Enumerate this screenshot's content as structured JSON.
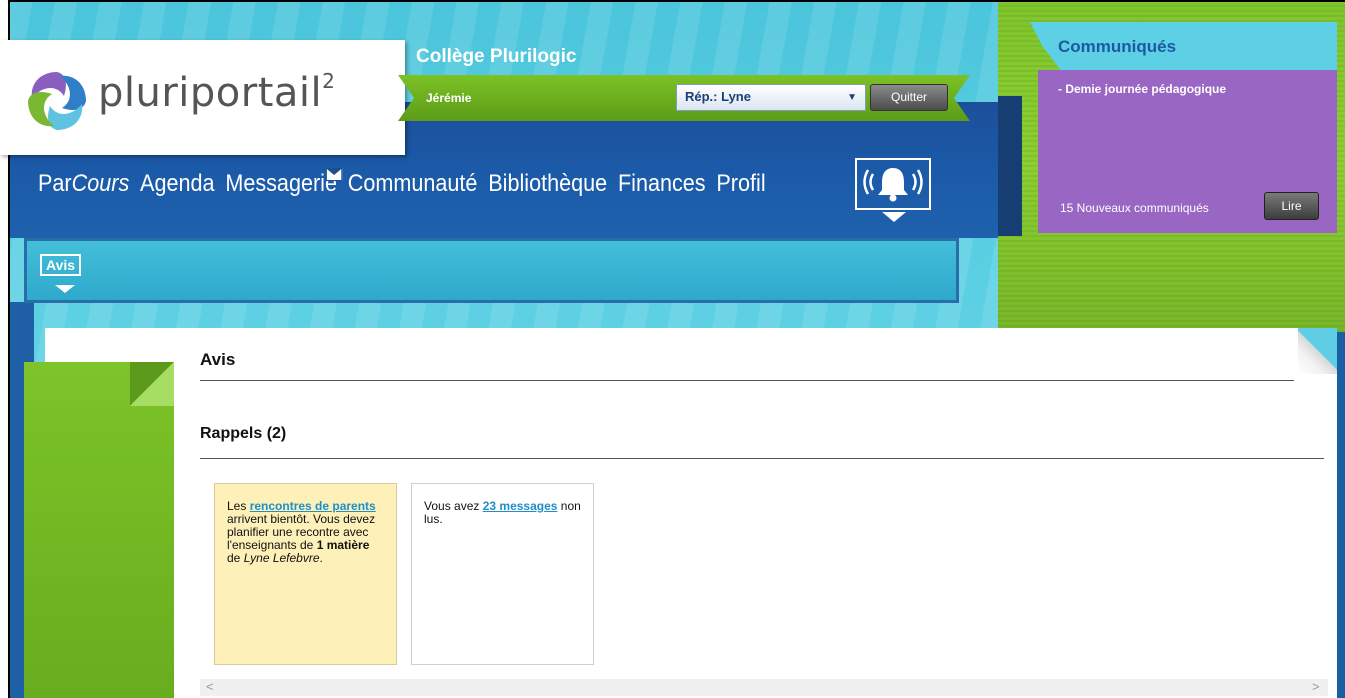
{
  "header": {
    "logo_text": "pluriportail",
    "logo_sup": "2",
    "school": "Collège Plurilogic",
    "user": "Jérémie",
    "rep_select": "Rép.: Lyne",
    "quit_label": "Quitter"
  },
  "nav": {
    "items": [
      {
        "prefix": "Par",
        "italic": "Cours"
      },
      {
        "label": "Agenda"
      },
      {
        "label": "Messagerie"
      },
      {
        "label": "Communauté"
      },
      {
        "label": "Bibliothèque"
      },
      {
        "label": "Finances"
      },
      {
        "label": "Profil"
      }
    ]
  },
  "subheader": {
    "tag": "Avis"
  },
  "communiques": {
    "title": "Communiqués",
    "item": "- Demie journée pédagogique",
    "count_text": "15 Nouveaux communiqués",
    "read_label": "Lire"
  },
  "main": {
    "title": "Avis",
    "section_title": "Rappels (2)",
    "cards": [
      {
        "pre": "Les ",
        "link": "rencontres de parents",
        "mid": " arrivent bientôt. Vous devez planifier une recontre avec l'enseignants de ",
        "bold": "1 matière",
        "mid2": " de ",
        "italic": "Lyne Lefebvre",
        "post": "."
      },
      {
        "pre": "Vous avez ",
        "link": "23 messages",
        "post": " non lus."
      }
    ]
  },
  "colors": {
    "nav_band": "#1b5aa8",
    "ribbon_green": "#6cb020",
    "comm_purple": "#9a66c3",
    "comm_title": "#1d5aa0",
    "reminder_yellow": "#fdf0b8",
    "link": "#1f8fc9"
  },
  "icons": [
    "logo-swirl-icon",
    "mail-icon",
    "bell-icon",
    "dropdown-caret-icon",
    "scroll-left-icon",
    "scroll-right-icon"
  ]
}
